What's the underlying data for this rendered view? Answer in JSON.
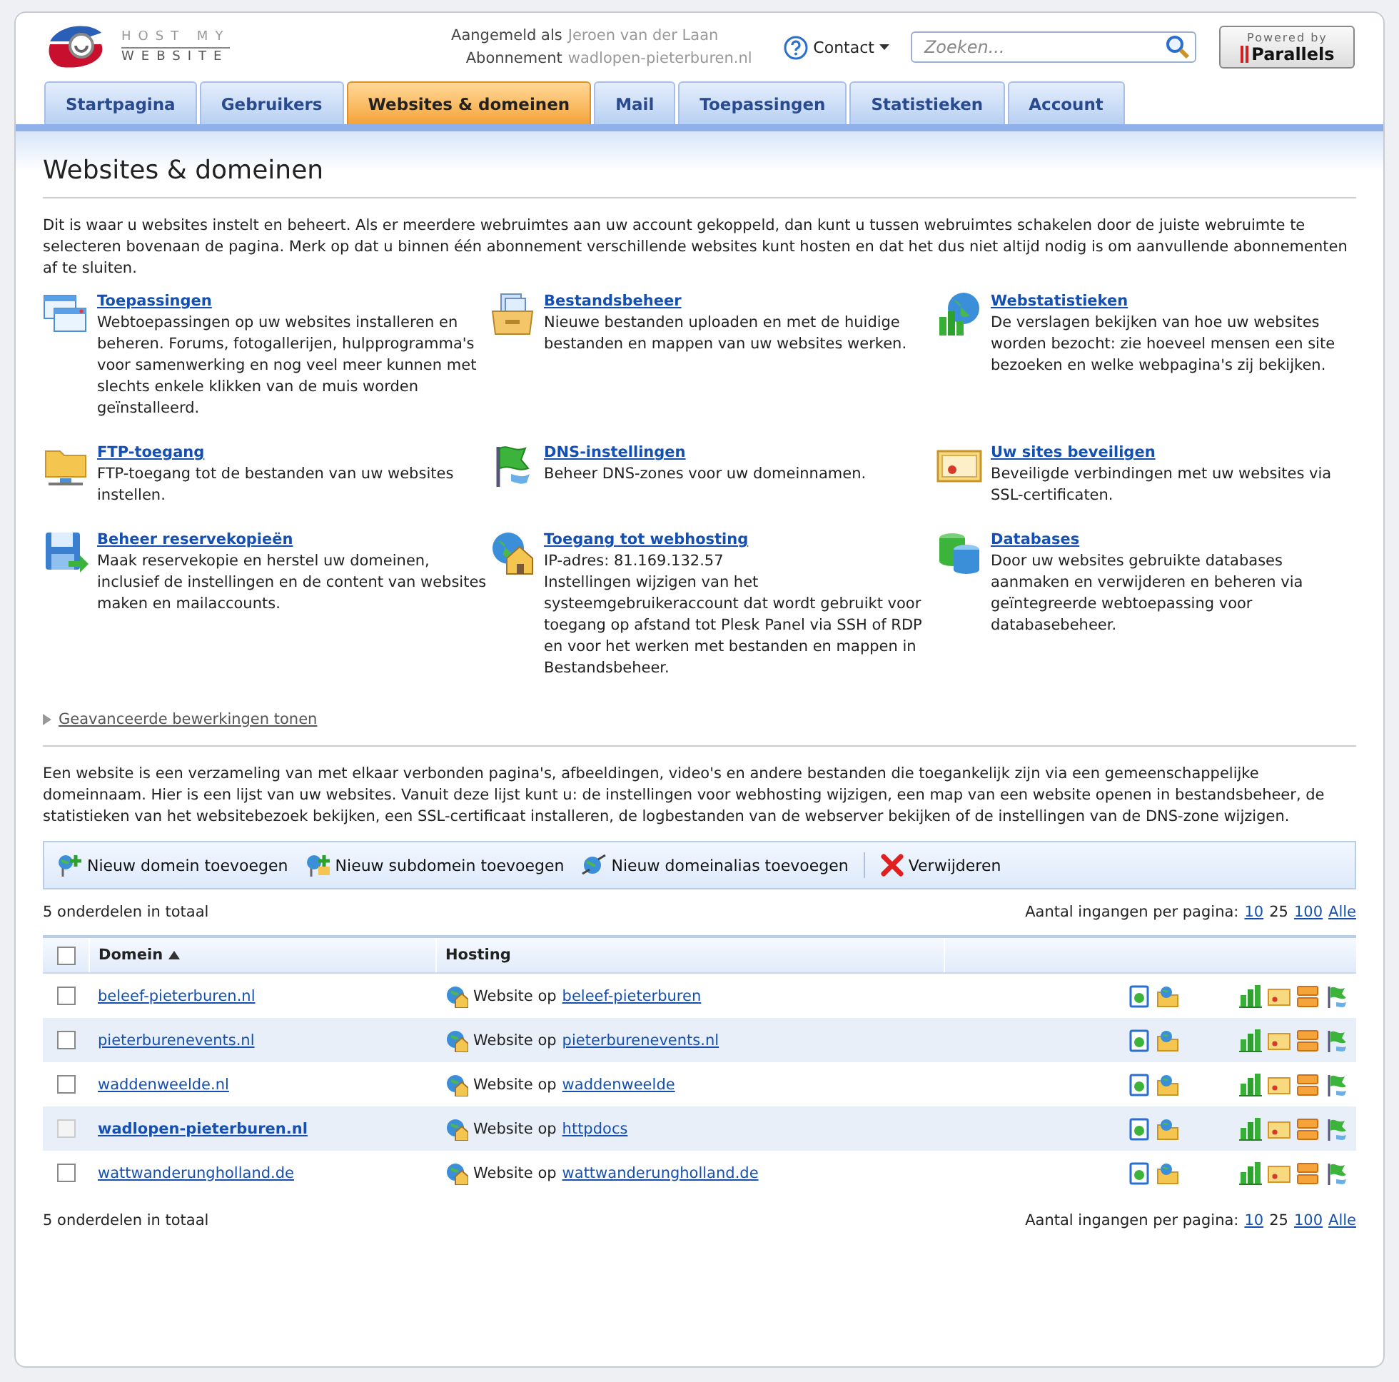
{
  "header": {
    "logo_top": "HOST MY",
    "logo_bottom": "WEBSITE",
    "login_label": "Aangemeld als",
    "login_value": "Jeroen van der Laan",
    "subscription_label": "Abonnement",
    "subscription_value": "wadlopen-pieterburen.nl",
    "contact": "Contact",
    "search": {
      "placeholder": "Zoeken..."
    },
    "powered_by": "Powered by",
    "brand": "Parallels"
  },
  "tabs": [
    {
      "label": "Startpagina",
      "selected": false
    },
    {
      "label": "Gebruikers",
      "selected": false
    },
    {
      "label": "Websites & domeinen",
      "selected": true
    },
    {
      "label": "Mail",
      "selected": false
    },
    {
      "label": "Toepassingen",
      "selected": false
    },
    {
      "label": "Statistieken",
      "selected": false
    },
    {
      "label": "Account",
      "selected": false
    }
  ],
  "page": {
    "title": "Websites & domeinen",
    "intro": "Dit is waar u websites instelt en beheert. Als er meerdere webruimtes aan uw account gekoppeld, dan kunt u tussen webruimtes schakelen door de juiste webruimte te selecteren bovenaan de pagina. Merk op dat u binnen één abonnement verschillende websites kunt hosten en dat het dus niet altijd nodig is om aanvullende abonnementen af te sluiten."
  },
  "tools": [
    {
      "title": "Toepassingen",
      "paragraphs": [
        "Webtoepassingen op uw websites installeren en beheren. Forums, fotogallerijen, hulpprogramma's voor samenwerking en nog veel meer kunnen met slechts enkele klikken van de muis worden geïnstalleerd."
      ]
    },
    {
      "title": "Bestandsbeheer",
      "paragraphs": [
        "Nieuwe bestanden uploaden en met de huidige bestanden en mappen van uw websites werken."
      ]
    },
    {
      "title": "Webstatistieken",
      "paragraphs": [
        "De verslagen bekijken van hoe uw websites worden bezocht: zie hoeveel mensen een site bezoeken en welke webpagina's zij bekijken."
      ]
    },
    {
      "title": "FTP-toegang",
      "paragraphs": [
        "FTP-toegang tot de bestanden van uw websites instellen."
      ]
    },
    {
      "title": "DNS-instellingen",
      "paragraphs": [
        "Beheer DNS-zones voor uw domeinnamen."
      ]
    },
    {
      "title": "Uw sites beveiligen",
      "paragraphs": [
        "Beveiligde verbindingen met uw websites via SSL-certificaten."
      ]
    },
    {
      "title": "Beheer reservekopieën",
      "paragraphs": [
        "Maak reservekopie en herstel uw domeinen, inclusief de instellingen en de content van websites maken en mailaccounts."
      ]
    },
    {
      "title": "Toegang tot webhosting",
      "paragraphs": [
        "IP-adres: 81.169.132.57",
        "Instellingen wijzigen van het systeemgebruikeraccount dat wordt gebruikt voor toegang op afstand tot Plesk Panel via SSH of RDP en voor het werken met bestanden en mappen in Bestandsbeheer."
      ]
    },
    {
      "title": "Databases",
      "paragraphs": [
        "Door uw websites gebruikte databases aanmaken en verwijderen en beheren via geïntegreerde webtoepassing voor databasebeheer."
      ]
    }
  ],
  "advanced": "Geavanceerde bewerkingen tonen",
  "list_intro": "Een website is een verzameling van met elkaar verbonden pagina's, afbeeldingen, video's en andere bestanden die toegankelijk zijn via een gemeenschappelijke domeinnaam. Hier is een lijst van uw websites. Vanuit deze lijst kunt u: de instellingen voor webhosting wijzigen, een map van een website openen in bestandsbeheer, de statistieken van het websitebezoek bekijken, een SSL-certificaat installeren, de logbestanden van de webserver bekijken of de instellingen van de DNS-zone wijzigen.",
  "toolbar": [
    "Nieuw domein toevoegen",
    "Nieuw subdomein toevoegen",
    "Nieuw domeinalias toevoegen",
    "Verwijderen"
  ],
  "count_top": "5 onderdelen in totaal",
  "per_page_top": {
    "label": "Aantal ingangen per pagina:",
    "options": [
      {
        "label": "10",
        "selected": false
      },
      {
        "label": "25",
        "selected": true
      },
      {
        "label": "100",
        "selected": false
      },
      {
        "label": "Alle",
        "selected": false
      }
    ]
  },
  "table": {
    "columns": [
      {
        "label": "Domein",
        "sorted": true
      },
      {
        "label": "Hosting",
        "sorted": false
      }
    ],
    "all_checked": false,
    "rows": [
      {
        "checked": false,
        "disabled": false,
        "bold": false,
        "domain": "beleef-pieterburen.nl",
        "hosting_prefix": "Website op",
        "hosting_target": "beleef-pieterburen"
      },
      {
        "checked": false,
        "disabled": false,
        "bold": false,
        "domain": "pieterburenevents.nl",
        "hosting_prefix": "Website op",
        "hosting_target": "pieterburenevents.nl"
      },
      {
        "checked": false,
        "disabled": false,
        "bold": false,
        "domain": "waddenweelde.nl",
        "hosting_prefix": "Website op",
        "hosting_target": "waddenweelde"
      },
      {
        "checked": false,
        "disabled": true,
        "bold": true,
        "domain": "wadlopen-pieterburen.nl",
        "hosting_prefix": "Website op",
        "hosting_target": "httpdocs"
      },
      {
        "checked": false,
        "disabled": false,
        "bold": false,
        "domain": "wattwanderungholland.de",
        "hosting_prefix": "Website op",
        "hosting_target": "wattwanderungholland.de"
      }
    ]
  },
  "count_bottom": "5 onderdelen in totaal",
  "per_page_bottom": {
    "label": "Aantal ingangen per pagina:",
    "options": [
      {
        "label": "10",
        "selected": false
      },
      {
        "label": "25",
        "selected": true
      },
      {
        "label": "100",
        "selected": false
      },
      {
        "label": "Alle",
        "selected": false
      }
    ]
  }
}
